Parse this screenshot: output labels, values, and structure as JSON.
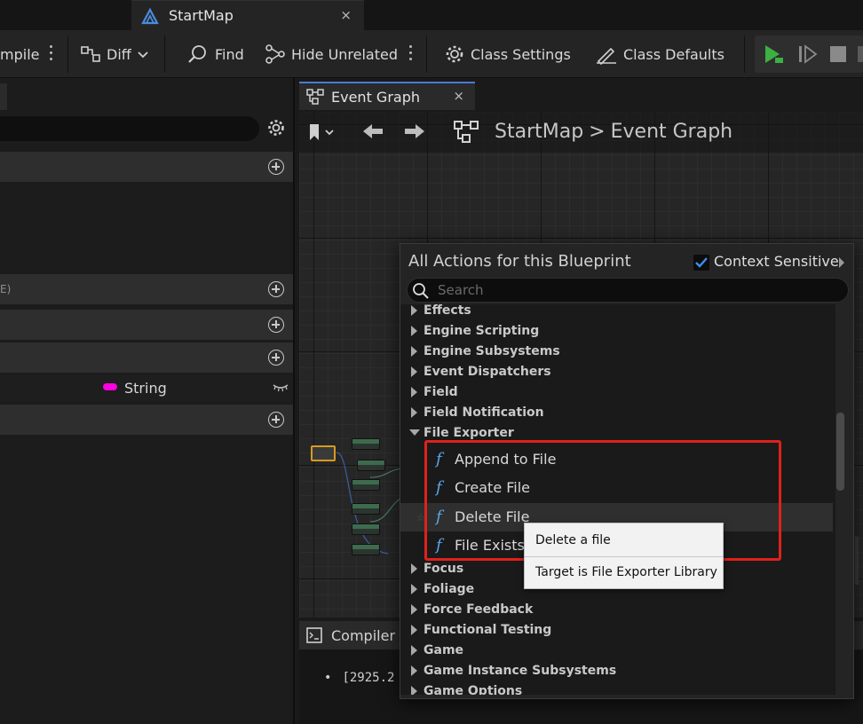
{
  "document_tab": {
    "title": "StartMap",
    "close": "×"
  },
  "toolbar": {
    "compile_label": "mpile",
    "diff_label": "Diff",
    "find_label": "Find",
    "hide_unrelated_label": "Hide Unrelated",
    "class_settings_label": "Class Settings",
    "class_defaults_label": "Class Defaults"
  },
  "left_panel": {
    "truncated_header": "E)",
    "variable_type": "String",
    "variable_type_color": "#ff00e0"
  },
  "graph": {
    "tab_label": "Event Graph",
    "tab_close": "×",
    "breadcrumb_root": "StartMap",
    "breadcrumb_sep": ">",
    "breadcrumb_current": "Event Graph"
  },
  "compiler": {
    "header_label": "Compiler R",
    "log_line": "[2925.2"
  },
  "action_menu": {
    "title": "All Actions for this Blueprint",
    "context_sensitive_label": "Context Sensitive",
    "context_sensitive_checked": true,
    "search_placeholder": "Search",
    "categories_top": [
      "Effects",
      "Engine Scripting",
      "Engine Subsystems",
      "Event Dispatchers",
      "Field",
      "Field Notification"
    ],
    "open_category": "File Exporter",
    "functions": [
      "Append to File",
      "Create File",
      "Delete File",
      "File Exists"
    ],
    "hovered_function": "Delete File",
    "categories_bottom": [
      "Focus",
      "Foliage",
      "Force Feedback",
      "Functional Testing",
      "Game",
      "Game Instance Subsystems",
      "Game Options"
    ]
  },
  "tooltip": {
    "title": "Delete a file",
    "description": "Target is File Exporter Library"
  },
  "colors": {
    "accent_blue": "#4a7bd6",
    "function_icon": "#5aa4e8",
    "highlight_red": "#e0211c",
    "play_green": "#3cb043"
  }
}
